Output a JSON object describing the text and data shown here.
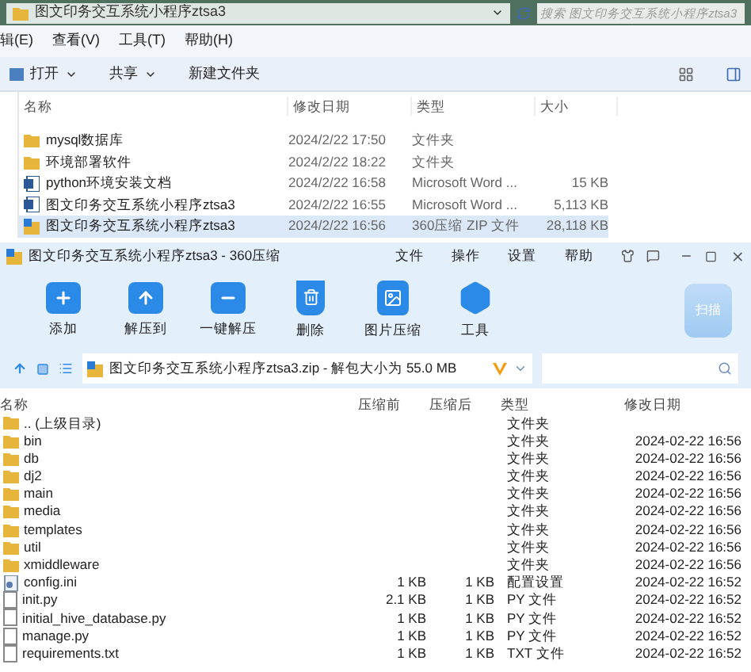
{
  "explorer": {
    "address": "图文印务交互系统小程序ztsa3",
    "search_placeholder": "搜索 图文印务交互系统小程序ztsa3",
    "menu": [
      "辑(E)",
      "查看(V)",
      "工具(T)",
      "帮助(H)"
    ],
    "toolbar": [
      {
        "label": "打开",
        "dropdown": true
      },
      {
        "label": "共享",
        "dropdown": true
      },
      {
        "label": "新建文件夹",
        "dropdown": false
      }
    ],
    "columns": [
      "名称",
      "修改日期",
      "类型",
      "大小"
    ],
    "rows": [
      {
        "kind": "folder",
        "name": "mysql数据库",
        "date": "2024/2/22 17:50",
        "type": "文件夹",
        "size": "",
        "selected": false
      },
      {
        "kind": "folder",
        "name": "环境部署软件",
        "date": "2024/2/22 18:22",
        "type": "文件夹",
        "size": "",
        "selected": false
      },
      {
        "kind": "word",
        "name": "python环境安装文档",
        "date": "2024/2/22 16:58",
        "type": "Microsoft Word ...",
        "size": "15 KB",
        "selected": false
      },
      {
        "kind": "word",
        "name": "图文印务交互系统小程序ztsa3",
        "date": "2024/2/22 16:55",
        "type": "Microsoft Word ...",
        "size": "5,113 KB",
        "selected": false
      },
      {
        "kind": "zip",
        "name": "图文印务交互系统小程序ztsa3",
        "date": "2024/2/22 16:56",
        "type": "360压缩 ZIP 文件",
        "size": "28,118 KB",
        "selected": true
      }
    ]
  },
  "archiver": {
    "title": "图文印务交互系统小程序ztsa3 - 360压缩",
    "menu": [
      "文件",
      "操作",
      "设置",
      "帮助"
    ],
    "tools": [
      {
        "kind": "add",
        "label": "添加"
      },
      {
        "kind": "extract",
        "label": "解压到"
      },
      {
        "kind": "oneclick",
        "label": "一键解压"
      },
      {
        "kind": "delete",
        "label": "删除"
      },
      {
        "kind": "image",
        "label": "图片压缩"
      },
      {
        "kind": "tools",
        "label": "工具"
      }
    ],
    "scan": "扫描",
    "path": "图文印务交互系统小程序ztsa3.zip - 解包大小为 55.0 MB",
    "columns": [
      "名称",
      "压缩前",
      "压缩后",
      "类型",
      "修改日期"
    ],
    "rows": [
      {
        "kind": "folder",
        "name": ".. (上级目录)",
        "before": "",
        "after": "",
        "type": "文件夹",
        "date": ""
      },
      {
        "kind": "folder",
        "name": "bin",
        "before": "",
        "after": "",
        "type": "文件夹",
        "date": "2024-02-22 16:56"
      },
      {
        "kind": "folder",
        "name": "db",
        "before": "",
        "after": "",
        "type": "文件夹",
        "date": "2024-02-22 16:56"
      },
      {
        "kind": "folder",
        "name": "dj2",
        "before": "",
        "after": "",
        "type": "文件夹",
        "date": "2024-02-22 16:56"
      },
      {
        "kind": "folder",
        "name": "main",
        "before": "",
        "after": "",
        "type": "文件夹",
        "date": "2024-02-22 16:56"
      },
      {
        "kind": "folder",
        "name": "media",
        "before": "",
        "after": "",
        "type": "文件夹",
        "date": "2024-02-22 16:56"
      },
      {
        "kind": "folder",
        "name": "templates",
        "before": "",
        "after": "",
        "type": "文件夹",
        "date": "2024-02-22 16:56"
      },
      {
        "kind": "folder",
        "name": "util",
        "before": "",
        "after": "",
        "type": "文件夹",
        "date": "2024-02-22 16:56"
      },
      {
        "kind": "folder",
        "name": "xmiddleware",
        "before": "",
        "after": "",
        "type": "文件夹",
        "date": "2024-02-22 16:56"
      },
      {
        "kind": "config",
        "name": "config.ini",
        "before": "1 KB",
        "after": "1 KB",
        "type": "配置设置",
        "date": "2024-02-22 16:52"
      },
      {
        "kind": "file",
        "name": "init.py",
        "before": "2.1 KB",
        "after": "1 KB",
        "type": "PY 文件",
        "date": "2024-02-22 16:52"
      },
      {
        "kind": "file",
        "name": "initial_hive_database.py",
        "before": "1 KB",
        "after": "1 KB",
        "type": "PY 文件",
        "date": "2024-02-22 16:52"
      },
      {
        "kind": "file",
        "name": "manage.py",
        "before": "1 KB",
        "after": "1 KB",
        "type": "PY 文件",
        "date": "2024-02-22 16:52"
      },
      {
        "kind": "file",
        "name": "requirements.txt",
        "before": "1 KB",
        "after": "1 KB",
        "type": "TXT 文件",
        "date": "2024-02-22 16:52"
      }
    ]
  }
}
